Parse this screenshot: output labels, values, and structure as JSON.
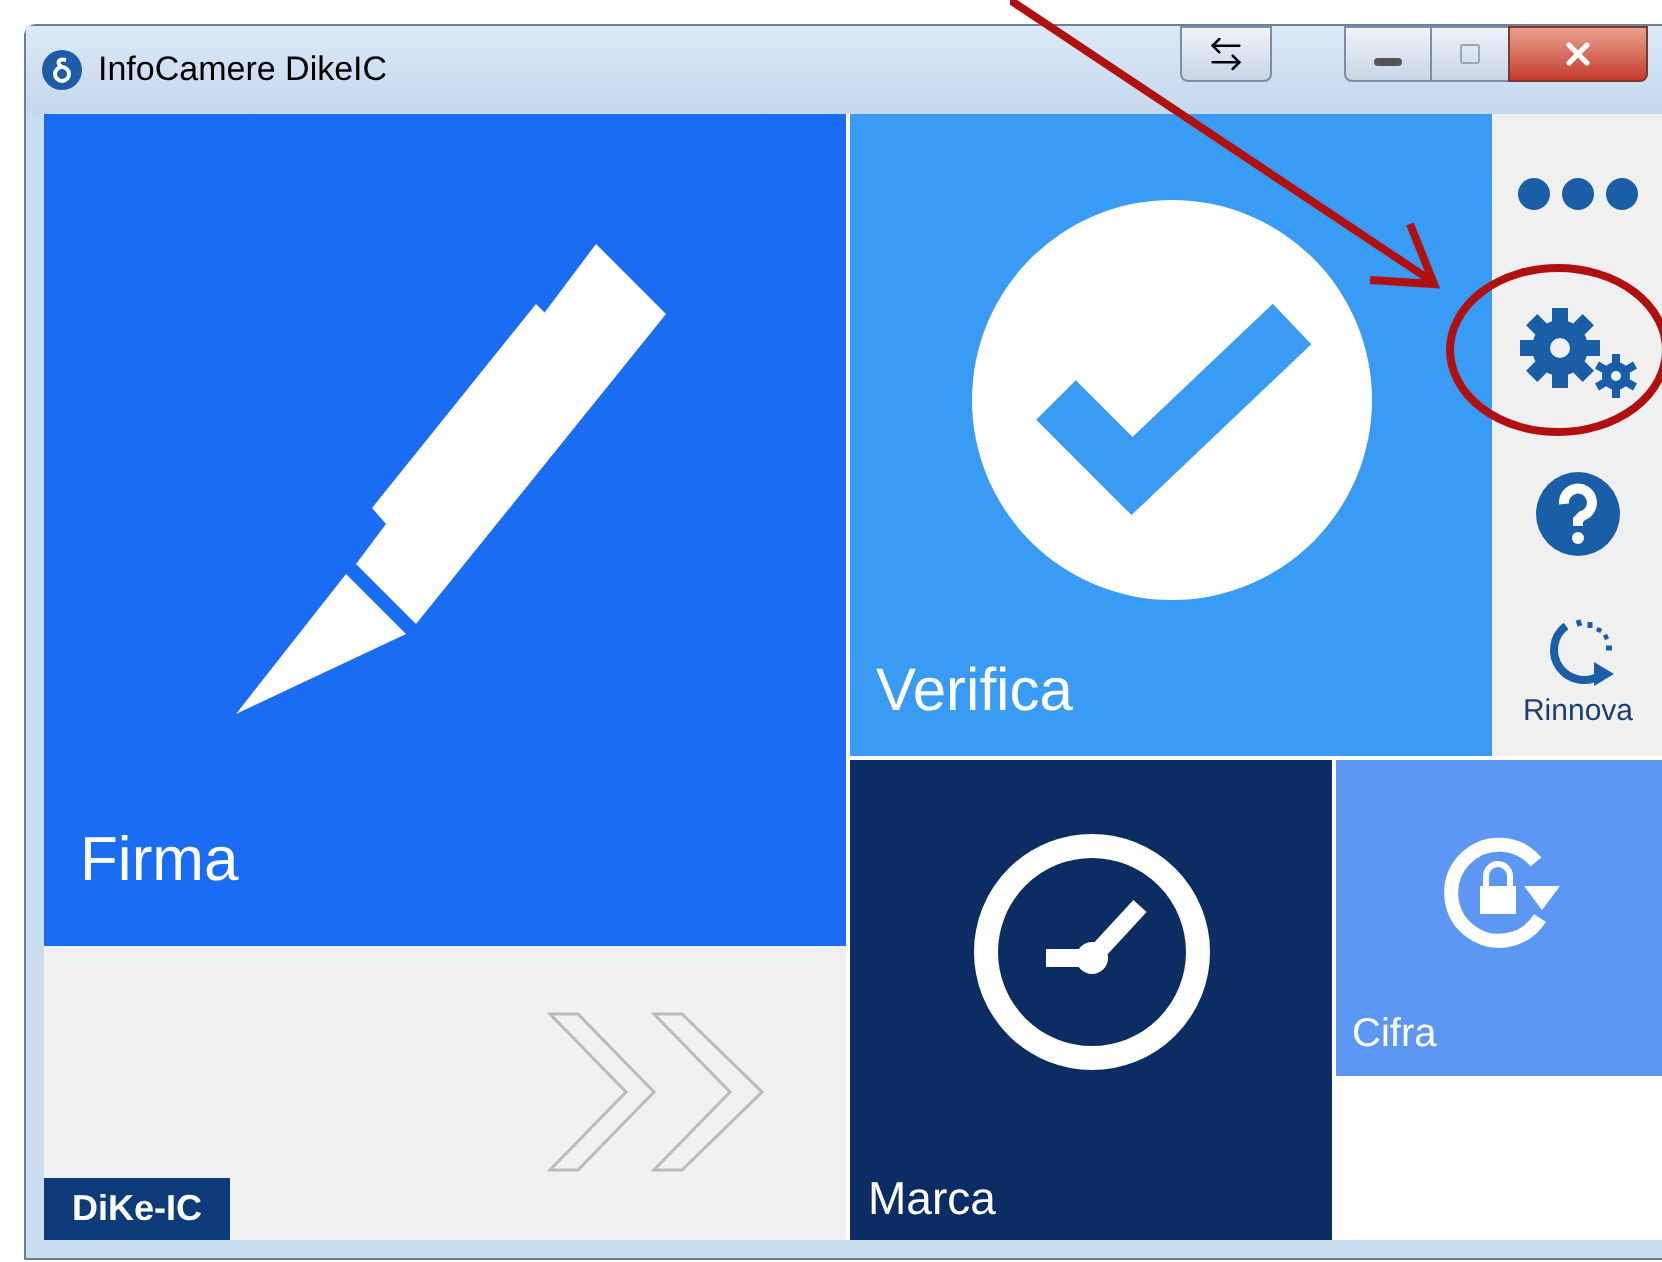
{
  "window": {
    "title": "InfoCamere DikeIC"
  },
  "tiles": [
    {
      "kind": "sign",
      "label": "Firma"
    },
    {
      "kind": "verify",
      "label": "Verifica"
    },
    {
      "kind": "timestamp",
      "label": "Marca"
    },
    {
      "kind": "encrypt",
      "label": "Cifra"
    }
  ],
  "sidebar": {
    "items": [
      {
        "kind": "more"
      },
      {
        "kind": "settings"
      },
      {
        "kind": "help"
      },
      {
        "kind": "renew",
        "label": "Rinnova"
      }
    ]
  },
  "footer": {
    "badge": "DiKe-IC"
  }
}
